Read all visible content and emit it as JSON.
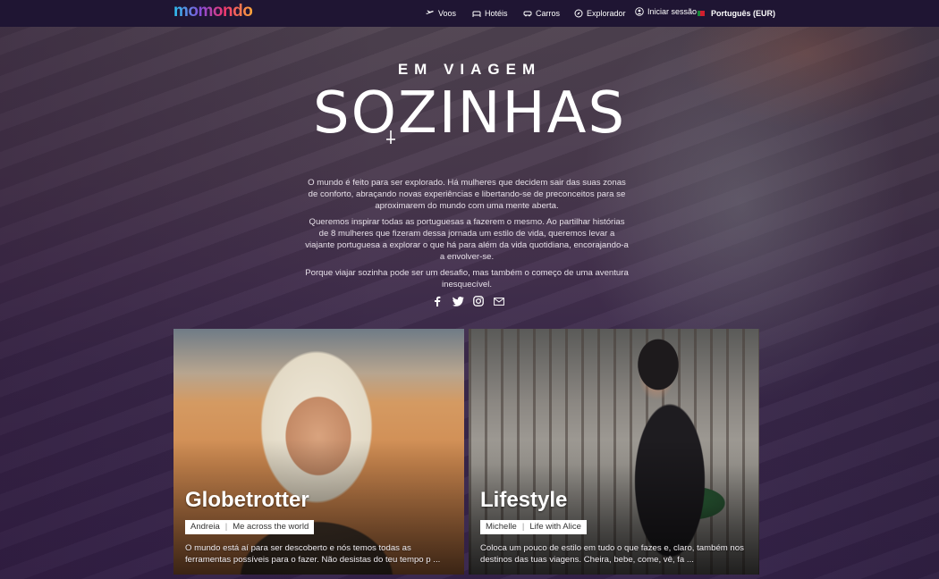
{
  "brand": {
    "logo_text": "momondo"
  },
  "nav": {
    "voos": "Voos",
    "hoteis": "Hotéis",
    "carros": "Carros",
    "explorador": "Explorador",
    "login": "Iniciar sessão",
    "language": "Português (EUR)"
  },
  "hero": {
    "kicker": "EM VIAGEM",
    "headline": "SOZINHAS",
    "paragraphs": [
      "O mundo é feito para ser explorado. Há mulheres que decidem sair das suas zonas de conforto, abraçando novas experiências e libertando-se de preconceitos para se aproximarem do mundo com uma mente aberta.",
      "Queremos inspirar todas as portuguesas a fazerem o mesmo. Ao partilhar histórias de 8 mulheres que fizeram dessa jornada um estilo de vida, queremos levar a viajante portuguesa a explorar o que há para além da vida quotidiana, encorajando-a a envolver-se.",
      "Porque viajar sozinha pode ser um desafio, mas também o começo de uma aventura inesquecível."
    ]
  },
  "social": [
    "facebook-icon",
    "twitter-icon",
    "instagram-icon",
    "email-icon"
  ],
  "cards": [
    {
      "title": "Globetrotter",
      "author": "Andreia",
      "blog": "Me across the world",
      "description": "O mundo está aí para ser descoberto e nós temos todas as ferramentas possíveis para o fazer. Não desistas do teu tempo p ..."
    },
    {
      "title": "Lifestyle",
      "author": "Michelle",
      "blog": "Life with Alice",
      "description": "Coloca um pouco de estilo em tudo o que fazes e, claro, também nos destinos das tuas viagens. Cheira, bebe, come, vê, fa ..."
    }
  ],
  "colors": {
    "topbar": "#1f1533",
    "background": "#3a2746"
  }
}
